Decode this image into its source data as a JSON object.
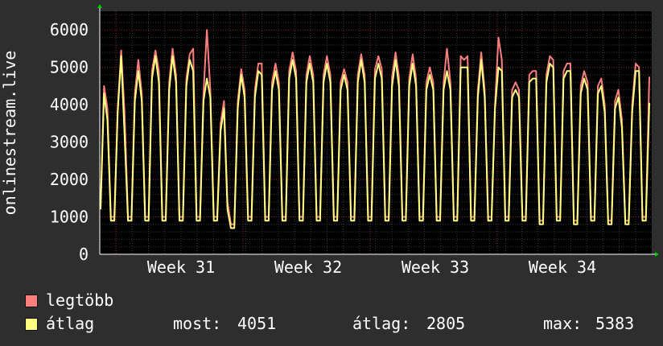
{
  "chart_data": {
    "type": "line",
    "ylabel": "onlinestream.live",
    "ylim": [
      0,
      6500
    ],
    "yticks": [
      0,
      1000,
      2000,
      3000,
      4000,
      5000,
      6000
    ],
    "x_tick_labels": [
      "Week 31",
      "Week 32",
      "Week 33",
      "Week 34"
    ],
    "grid": true,
    "series": [
      {
        "name": "legtöbb",
        "color": "#ff7f7f",
        "values": [
          1300,
          4500,
          3900,
          1000,
          1000,
          3900,
          5450,
          3800,
          1000,
          1000,
          4300,
          5200,
          4300,
          1000,
          1000,
          4900,
          5450,
          4900,
          1000,
          1000,
          4600,
          5500,
          4800,
          1000,
          1000,
          4700,
          5350,
          5500,
          1000,
          1000,
          4300,
          6000,
          4400,
          1000,
          1000,
          3500,
          4100,
          1400,
          800,
          800,
          4100,
          4950,
          4400,
          1000,
          1000,
          4400,
          5100,
          5100,
          1000,
          1000,
          4600,
          5100,
          4600,
          1000,
          1000,
          4900,
          5400,
          4900,
          1000,
          1000,
          4800,
          5300,
          4800,
          1000,
          1000,
          4800,
          5300,
          4800,
          1000,
          1000,
          4600,
          4950,
          4600,
          1000,
          1000,
          4800,
          5350,
          4800,
          1000,
          1000,
          4950,
          5300,
          4950,
          1000,
          1000,
          4750,
          5400,
          4750,
          1000,
          1000,
          4700,
          5350,
          4700,
          1000,
          1000,
          4600,
          5000,
          4600,
          1000,
          1000,
          4600,
          5500,
          4600,
          1000,
          1000,
          5300,
          5200,
          5300,
          1000,
          1000,
          4400,
          5400,
          4400,
          1000,
          1000,
          4000,
          5800,
          5200,
          1000,
          1000,
          4400,
          4600,
          4400,
          1000,
          1000,
          4800,
          4900,
          4900,
          900,
          900,
          4800,
          5300,
          5200,
          1000,
          1000,
          4900,
          5100,
          5100,
          900,
          900,
          4500,
          4900,
          4600,
          1000,
          1000,
          4500,
          4700,
          4000,
          900,
          900,
          4100,
          4400,
          3600,
          900,
          900,
          4000,
          5100,
          5000,
          1000,
          1000,
          4750
        ]
      },
      {
        "name": "átlag",
        "color": "#ffff80",
        "values": [
          1200,
          4300,
          3600,
          900,
          900,
          3800,
          5300,
          3200,
          900,
          900,
          4100,
          4900,
          4100,
          900,
          900,
          4700,
          5300,
          4600,
          900,
          900,
          4400,
          5300,
          4600,
          900,
          900,
          4500,
          5200,
          4900,
          900,
          900,
          4100,
          4700,
          4200,
          900,
          900,
          3300,
          3900,
          1200,
          700,
          700,
          3900,
          4800,
          4200,
          900,
          900,
          4200,
          4900,
          4800,
          900,
          900,
          4400,
          4900,
          4400,
          900,
          900,
          4700,
          5200,
          4700,
          900,
          900,
          4600,
          5100,
          4600,
          900,
          900,
          4600,
          5100,
          4600,
          900,
          900,
          4400,
          4800,
          4400,
          900,
          900,
          4600,
          5200,
          4600,
          900,
          900,
          4700,
          5100,
          4700,
          900,
          900,
          4500,
          5200,
          4500,
          900,
          900,
          4500,
          5100,
          4500,
          900,
          900,
          4400,
          4800,
          4400,
          900,
          900,
          4400,
          4900,
          4400,
          900,
          900,
          5000,
          5000,
          5000,
          900,
          900,
          4200,
          5200,
          4200,
          900,
          900,
          3900,
          5000,
          4900,
          900,
          900,
          4200,
          4400,
          4200,
          900,
          900,
          4600,
          4700,
          4700,
          800,
          800,
          4600,
          5100,
          5000,
          900,
          900,
          4700,
          4900,
          4900,
          800,
          800,
          4300,
          4700,
          4400,
          900,
          900,
          4300,
          4500,
          3800,
          800,
          800,
          3900,
          4200,
          3400,
          800,
          800,
          3800,
          4900,
          4900,
          900,
          900,
          4051
        ]
      }
    ],
    "legend": [
      {
        "name": "legtöbb",
        "color": "#ff7f7f"
      },
      {
        "name": "átlag",
        "color": "#ffff80"
      }
    ],
    "stats": {
      "most_label": "most:",
      "most_value": "4051",
      "atlag_label": "átlag:",
      "atlag_value": "2805",
      "max_label": "max:",
      "max_value": "5383"
    }
  }
}
